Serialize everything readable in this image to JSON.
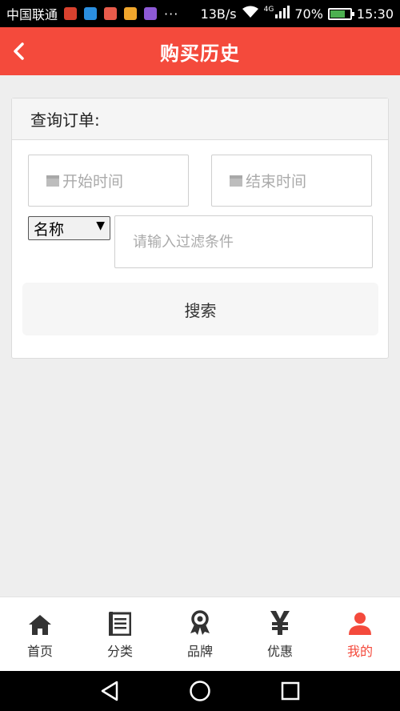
{
  "status_bar": {
    "carrier": "中国联通",
    "dots": "···",
    "net_speed": "13B/s",
    "network": "4G",
    "battery": "70%",
    "battery_level": 0.7,
    "time": "15:30"
  },
  "header": {
    "title": "购买历史",
    "background": "#f44a3c"
  },
  "query": {
    "heading": "查询订单:",
    "start_date_placeholder": "开始时间",
    "end_date_placeholder": "结束时间",
    "select_value": "名称",
    "select_arrow": "▼",
    "filter_placeholder": "请输入过滤条件",
    "search_label": "搜索"
  },
  "tabs": [
    {
      "label": "首页",
      "icon": "home-icon"
    },
    {
      "label": "分类",
      "icon": "list-icon"
    },
    {
      "label": "品牌",
      "icon": "award-icon"
    },
    {
      "label": "优惠",
      "icon": "yen-icon"
    },
    {
      "label": "我的",
      "icon": "user-icon",
      "active": true
    }
  ],
  "colors": {
    "accent": "#f44a3c",
    "page_bg": "#eeeeee"
  }
}
